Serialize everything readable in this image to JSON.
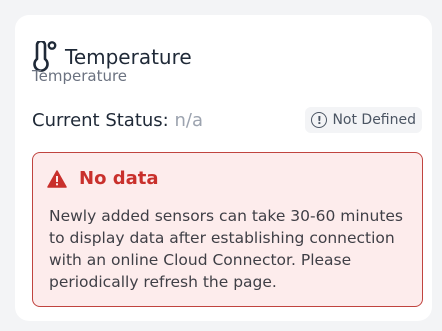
{
  "card": {
    "icon": "thermometer-icon",
    "title": "Temperature",
    "subtitle": "Temperature",
    "status_label": "Current Status:",
    "status_value": "n/a",
    "badge": {
      "icon": "info-icon",
      "label": "Not Defined"
    },
    "alert": {
      "icon": "warning-triangle-icon",
      "title": "No data",
      "message": "Newly added sensors can take 30-60 minutes to display data after establishing connection with an online Cloud Connector. Please periodically refresh the page."
    }
  },
  "colors": {
    "alert_accent": "#c9302c",
    "alert_background": "#fdecec",
    "muted_text": "#6b7280"
  }
}
